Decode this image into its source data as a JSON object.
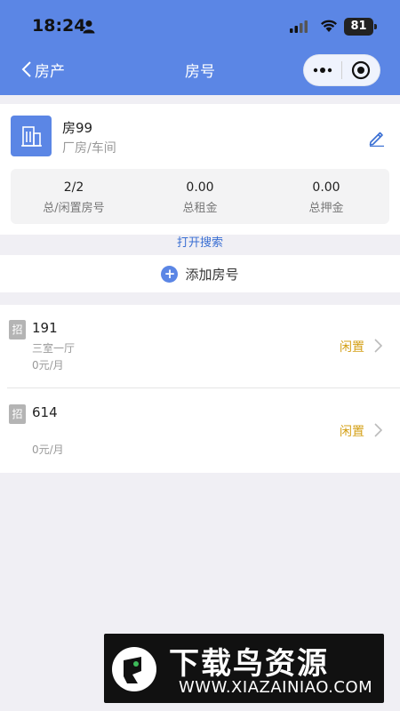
{
  "status_bar": {
    "time": "18:24",
    "battery": "81"
  },
  "nav": {
    "back_label": "房产",
    "title": "房号"
  },
  "property": {
    "name": "房99",
    "type": "厂房/车间"
  },
  "stats": [
    {
      "value": "2/2",
      "label": "总/闲置房号"
    },
    {
      "value": "0.00",
      "label": "总租金"
    },
    {
      "value": "0.00",
      "label": "总押金"
    }
  ],
  "search_link": "打开搜索",
  "add_room_label": "添加房号",
  "rooms": [
    {
      "badge": "招",
      "number": "191",
      "layout": "三室一厅",
      "rent": "0元/月",
      "status": "闲置"
    },
    {
      "badge": "招",
      "number": "614",
      "layout": "",
      "rent": "0元/月",
      "status": "闲置"
    }
  ],
  "watermark": {
    "title": "下载鸟资源",
    "url": "WWW.XIAZAINIAO.COM"
  },
  "colors": {
    "brand": "#5b86e5",
    "status_idle": "#d4a017",
    "link": "#3a6fd3"
  }
}
